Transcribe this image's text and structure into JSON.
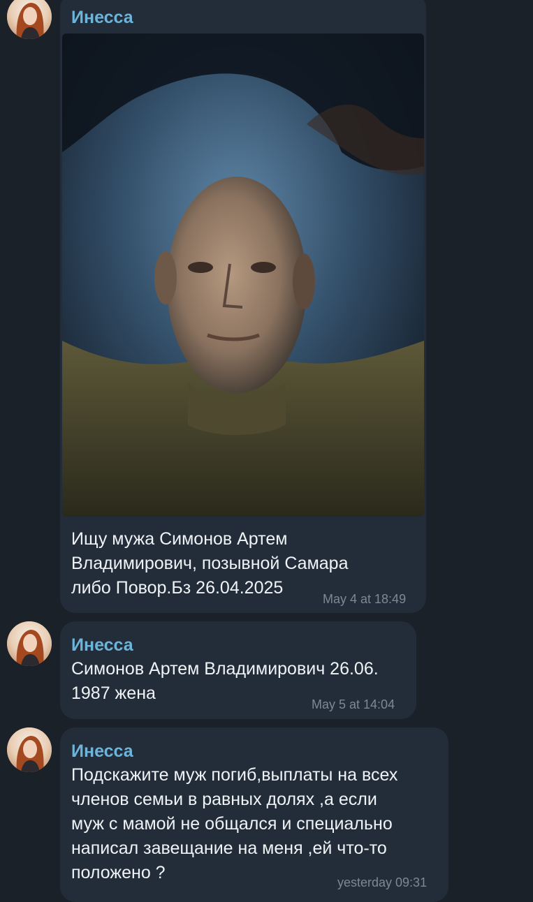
{
  "messages": [
    {
      "sender": "Инесса",
      "has_photo": true,
      "text": "Ищу мужа Симонов Артем\nВладимирович, позывной Самара\nлибо Повор.Бз 26.04.2025",
      "time": "May 4 at 18:49"
    },
    {
      "sender": "Инесса",
      "has_photo": false,
      "text": "Симонов Артем Владимирович 26.06.\n1987 жена",
      "time": "May 5 at 14:04"
    },
    {
      "sender": "Инесса",
      "has_photo": false,
      "text": "Подскажите муж погиб,выплаты на всех\nчленов семьи в равных долях ,а если\nмуж с мамой не общался и специально\nнаписал завещание на меня ,ей что-то\nположено ?",
      "time": "yesterday 09:31"
    }
  ],
  "colors": {
    "background": "#1a2129",
    "bubble": "#222d39",
    "sender": "#6cb4d9",
    "text": "#f0f3f6",
    "time": "#7c8995"
  }
}
